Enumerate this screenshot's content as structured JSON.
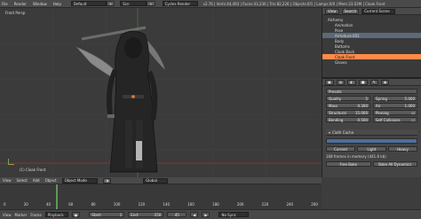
{
  "menu": {
    "items": [
      "File",
      "Render",
      "Window",
      "Help"
    ],
    "layout": "Default",
    "scene": "Scn",
    "engine": "Cycles Render",
    "stats": "v2.76 | Verts:44,493 | Faces:43,236 | Tris:82,226 | Objects:0/1 | Lamps:0/0 | Mem:33.03M | Cloak Front"
  },
  "viewport": {
    "view_label": "Front Persp",
    "object_label": "(1) Cloak Front"
  },
  "outliner": {
    "tabs": [
      "View",
      "Search",
      "Current Scene"
    ],
    "items": [
      {
        "label": "Alchemy",
        "level": 0,
        "state": ""
      },
      {
        "label": "Animation",
        "level": 1,
        "state": ""
      },
      {
        "label": "Pose",
        "level": 1,
        "state": ""
      },
      {
        "label": "Armature.001",
        "level": 1,
        "state": "sel"
      },
      {
        "label": "Body",
        "level": 1,
        "state": ""
      },
      {
        "label": "Bottoms",
        "level": 1,
        "state": ""
      },
      {
        "label": "Cloak Back",
        "level": 1,
        "state": ""
      },
      {
        "label": "Cloak Front",
        "level": 1,
        "state": "hi"
      },
      {
        "label": "Gloves",
        "level": 1,
        "state": ""
      }
    ]
  },
  "properties": {
    "rows": [
      [
        "Presets",
        ""
      ],
      [
        "Quality",
        "5"
      ],
      [
        "Mass",
        "0.300"
      ],
      [
        "Structural",
        "15.000"
      ],
      [
        "Bending",
        "0.500"
      ],
      [
        "Spring",
        "5.000"
      ],
      [
        "Air",
        "1.000"
      ],
      [
        "Pinning",
        ""
      ],
      [
        "Self Collisions",
        ""
      ],
      [
        "Cloth Cache",
        ""
      ]
    ],
    "cache_text": "168 frames in memory (441.6 kb)",
    "cache_buttons": [
      "Free Bake",
      "Bake All Dynamics"
    ],
    "cache_tabs": [
      "Current",
      "Light",
      "Heavy"
    ]
  },
  "timeline_header": {
    "items": [
      "View",
      "Select",
      "Add",
      "Object",
      "Object Mode",
      "Global"
    ]
  },
  "timeline": {
    "ticks": [
      "0",
      "20",
      "40",
      "60",
      "80",
      "100",
      "120",
      "140",
      "160",
      "180",
      "200",
      "220",
      "240",
      "260"
    ],
    "cursor_label": "45"
  },
  "footer": {
    "menus": [
      "View",
      "Marker",
      "Frame",
      "Playback"
    ],
    "start_label": "Start:",
    "start_value": "1",
    "end_label": "End:",
    "end_value": "250",
    "current_value": "45",
    "sync": "No Sync"
  },
  "colors": {
    "accent": "#ff8a4a",
    "select": "#5b6a7a",
    "viewport_bg": "#3b3b3b",
    "grid_red": "#7a3b3b",
    "grid_green": "#3f6a3f"
  }
}
